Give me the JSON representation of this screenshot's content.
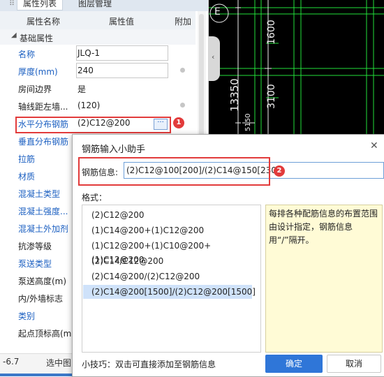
{
  "tabs": {
    "properties": "属性列表",
    "layers": "图层管理"
  },
  "columns": {
    "name": "属性名称",
    "value": "属性值",
    "extra": "附加"
  },
  "group": {
    "label": "基础属性"
  },
  "properties": [
    {
      "name": "名称",
      "value": "JLQ-1",
      "style": "link",
      "has_box": true,
      "has_dot": false
    },
    {
      "name": "厚度(mm)",
      "value": "240",
      "style": "link",
      "has_box": true,
      "has_dot": true
    },
    {
      "name": "房间边界",
      "value": "是",
      "style": "plain",
      "has_box": false,
      "has_dot": false
    },
    {
      "name": "轴线距左墙...",
      "value": "(120)",
      "style": "plain",
      "has_box": false,
      "has_dot": true
    },
    {
      "name": "水平分布钢筋",
      "value": "(2)C12@200",
      "style": "link",
      "has_box": false,
      "has_dot": false
    },
    {
      "name": "垂直分布钢筋",
      "value": "",
      "style": "link",
      "has_box": false,
      "has_dot": false
    },
    {
      "name": "拉筋",
      "value": "",
      "style": "link",
      "has_box": false,
      "has_dot": false
    },
    {
      "name": "材质",
      "value": "",
      "style": "link",
      "has_box": false,
      "has_dot": false
    },
    {
      "name": "混凝土类型",
      "value": "",
      "style": "link",
      "has_box": false,
      "has_dot": false
    },
    {
      "name": "混凝土强度...",
      "value": "",
      "style": "link",
      "has_box": false,
      "has_dot": false
    },
    {
      "name": "混凝土外加剂",
      "value": "",
      "style": "link",
      "has_box": false,
      "has_dot": false
    },
    {
      "name": "抗渗等级",
      "value": "",
      "style": "plain",
      "has_box": false,
      "has_dot": false
    },
    {
      "name": "泵送类型",
      "value": "",
      "style": "link",
      "has_box": false,
      "has_dot": false
    },
    {
      "name": "泵送高度(m)",
      "value": "",
      "style": "plain",
      "has_box": false,
      "has_dot": false
    },
    {
      "name": "内/外墙标志",
      "value": "",
      "style": "plain",
      "has_box": false,
      "has_dot": false
    },
    {
      "name": "类别",
      "value": "",
      "style": "link",
      "has_box": false,
      "has_dot": false
    },
    {
      "name": "起点顶标高(m)",
      "value": "",
      "style": "plain",
      "has_box": false,
      "has_dot": false
    }
  ],
  "edit_button": "···",
  "badges": {
    "one": "1",
    "two": "2"
  },
  "cad": {
    "axis_letter": "E",
    "dim_1600": "1600",
    "dim_13350": "13350",
    "dim_3100": "3100",
    "dim_5150": "5150",
    "colors": {
      "background": "#000000",
      "green": "#22e03a",
      "white": "#f0f0f0"
    }
  },
  "status": {
    "left": "-6.7",
    "center": "选中图"
  },
  "dialog": {
    "title": "钢筋输入小助手",
    "close": "✕",
    "info_label": "钢筋信息:",
    "info_value": "(2)C12@100[200]/(2)C14@150[2300",
    "format_label": "格式：",
    "formats": [
      "(2)C12@200",
      "(1)C14@200+(1)C12@200",
      "(1)C12@200+(1)C10@200+(1)C12@200",
      "(2)C14/C12@200",
      "(2)C14@200/(2)C12@200",
      "(2)C14@200[1500]/(2)C12@200[1500]"
    ],
    "selected_index": 5,
    "hint": "每排各种配筋信息的布置范围由设计指定，钢筋信息用“/”隔开。",
    "tip": "小技巧：双击可直接添加至钢筋信息",
    "ok": "确定",
    "cancel": "取消"
  },
  "colors": {
    "accent_blue": "#2f76d8",
    "link_blue": "#1b5fc1",
    "highlight_red": "#e23b3b"
  }
}
